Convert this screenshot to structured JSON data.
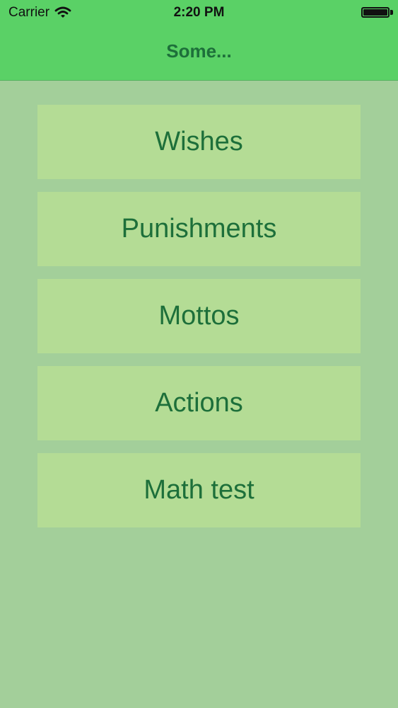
{
  "status_bar": {
    "carrier": "Carrier",
    "time": "2:20 PM",
    "battery_level": 1.0,
    "wifi_icon": "wifi-icon",
    "battery_icon": "battery-icon"
  },
  "nav": {
    "title": "Some..."
  },
  "menu": {
    "items": [
      {
        "label": "Wishes"
      },
      {
        "label": "Punishments"
      },
      {
        "label": "Mottos"
      },
      {
        "label": "Actions"
      },
      {
        "label": "Math test"
      }
    ]
  },
  "colors": {
    "nav_bar": "#5ad166",
    "background": "#a3cf9a",
    "button": "#b4dc95",
    "text": "#1d6f3a"
  }
}
